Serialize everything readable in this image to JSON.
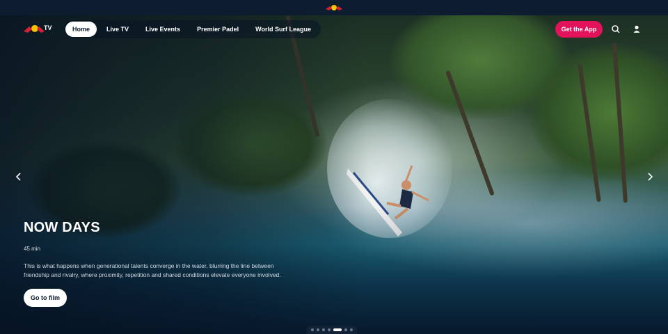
{
  "colors": {
    "accent": "#e2135b",
    "background": "#0b1a2c",
    "active_tab_bg": "#ffffff",
    "text": "#ffffff"
  },
  "header": {
    "top_logo": "red-bull-logo",
    "brand_logo": "red-bull-tv-logo"
  },
  "nav": {
    "items": [
      {
        "label": "Home",
        "active": true
      },
      {
        "label": "Live TV",
        "active": false
      },
      {
        "label": "Live Events",
        "active": false
      },
      {
        "label": "Premier Padel",
        "active": false
      },
      {
        "label": "World Surf League",
        "active": false
      }
    ],
    "get_app_label": "Get the App",
    "search_icon": "search-icon",
    "user_icon": "user-icon"
  },
  "hero": {
    "title": "NOW DAYS",
    "duration": "45 min",
    "description": "This is what happens when generational talents converge in the water, blurring the line between friendship and rivalry, where proximity, repetition and shared conditions elevate everyone involved.",
    "cta_label": "Go to film",
    "prev_icon": "chevron-left-icon",
    "next_icon": "chevron-right-icon"
  },
  "carousel": {
    "slide_count": 7,
    "active_index": 4
  }
}
